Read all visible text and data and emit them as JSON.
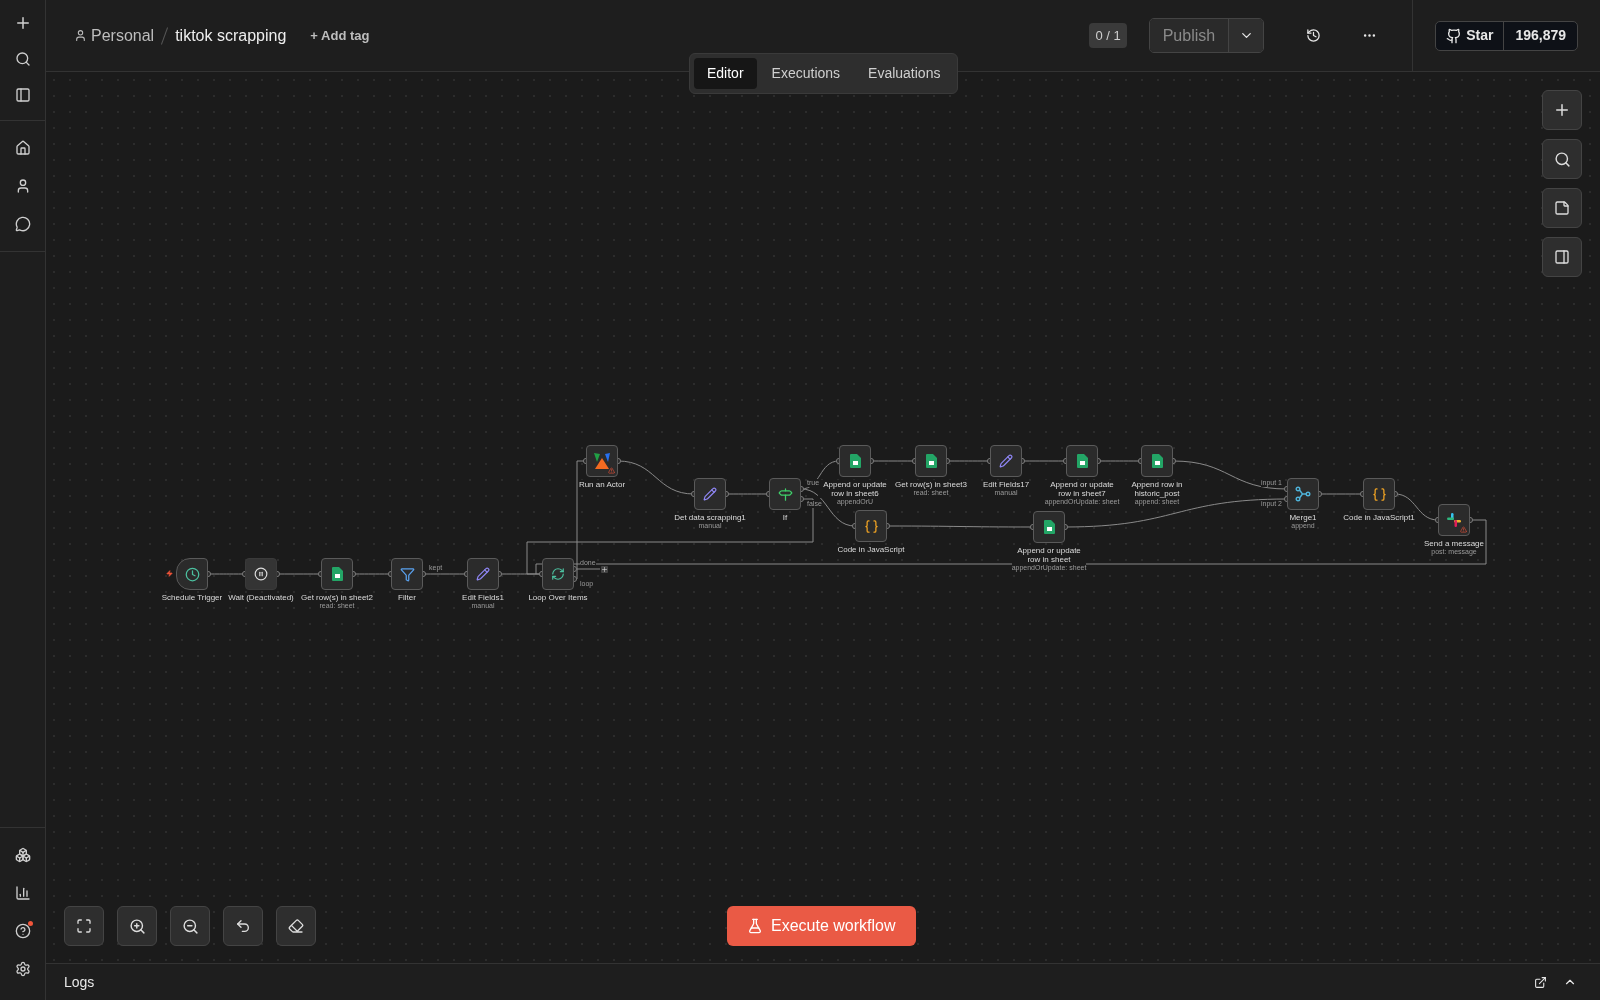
{
  "header": {
    "project": "Personal",
    "workflow_name": "tiktok scrapping",
    "add_tag": "+ Add tag",
    "version": "0 / 1",
    "publish": "Publish",
    "star": "Star",
    "star_count": "196,879"
  },
  "tabs": [
    {
      "label": "Editor",
      "selected": true
    },
    {
      "label": "Executions",
      "selected": false
    },
    {
      "label": "Evaluations",
      "selected": false
    }
  ],
  "nodes": [
    {
      "kind": "trigger",
      "label": "Schedule Trigger",
      "disabled": false,
      "warning": false
    },
    {
      "kind": "wait",
      "label": "Wait (Deactivated)",
      "disabled": true,
      "warning": false
    },
    {
      "kind": "sheets",
      "label": "Get row(s) in sheet2",
      "subtitle": "read: sheet",
      "disabled": false,
      "warning": false
    },
    {
      "kind": "filter",
      "label": "Filter",
      "outputs": [
        "kept"
      ],
      "disabled": false,
      "warning": false
    },
    {
      "kind": "edit",
      "label": "Edit Fields1",
      "subtitle": "manual",
      "disabled": false,
      "warning": false
    },
    {
      "kind": "loop",
      "label": "Loop Over Items",
      "outputs": [
        "done",
        "loop"
      ],
      "disabled": false,
      "warning": false
    },
    {
      "kind": "actor",
      "label": "Run an Actor",
      "disabled": false,
      "warning": true
    },
    {
      "kind": "edit",
      "label": "Det data scrapping1",
      "subtitle": "manual",
      "disabled": false,
      "warning": false
    },
    {
      "kind": "if",
      "label": "If",
      "outputs": [
        "true",
        "false"
      ],
      "disabled": false,
      "warning": false
    },
    {
      "kind": "sheets",
      "label": "Append or update row in sheet6",
      "subtitle": "appendOrU",
      "disabled": false,
      "warning": false
    },
    {
      "kind": "code",
      "label": "Code in JavaScript",
      "disabled": false,
      "warning": false
    },
    {
      "kind": "sheets",
      "label": "Get row(s) in sheet3",
      "subtitle": "read: sheet",
      "disabled": false,
      "warning": false
    },
    {
      "kind": "edit",
      "label": "Edit Fields17",
      "subtitle": "manual",
      "disabled": false,
      "warning": false
    },
    {
      "kind": "sheets",
      "label": "Append or update row in sheet7",
      "subtitle": "appendOrUpdate: sheet",
      "disabled": false,
      "warning": false
    },
    {
      "kind": "sheets",
      "label": "Append row in historic_post",
      "subtitle": "append: sheet",
      "disabled": false,
      "warning": false
    },
    {
      "kind": "sheets",
      "label": "Append or update row in sheet",
      "subtitle": "appendOrUpdate: sheet",
      "disabled": false,
      "warning": false
    },
    {
      "kind": "merge",
      "label": "Merge1",
      "subtitle": "append",
      "inputs": [
        "input 1",
        "input 2"
      ],
      "disabled": false,
      "warning": false
    },
    {
      "kind": "code",
      "label": "Code in JavaScript1",
      "disabled": false,
      "warning": false
    },
    {
      "kind": "slack",
      "label": "Send a message",
      "subtitle": "post: message",
      "disabled": false,
      "warning": true
    }
  ],
  "execute_button": "Execute workflow",
  "logs": {
    "title": "Logs"
  }
}
